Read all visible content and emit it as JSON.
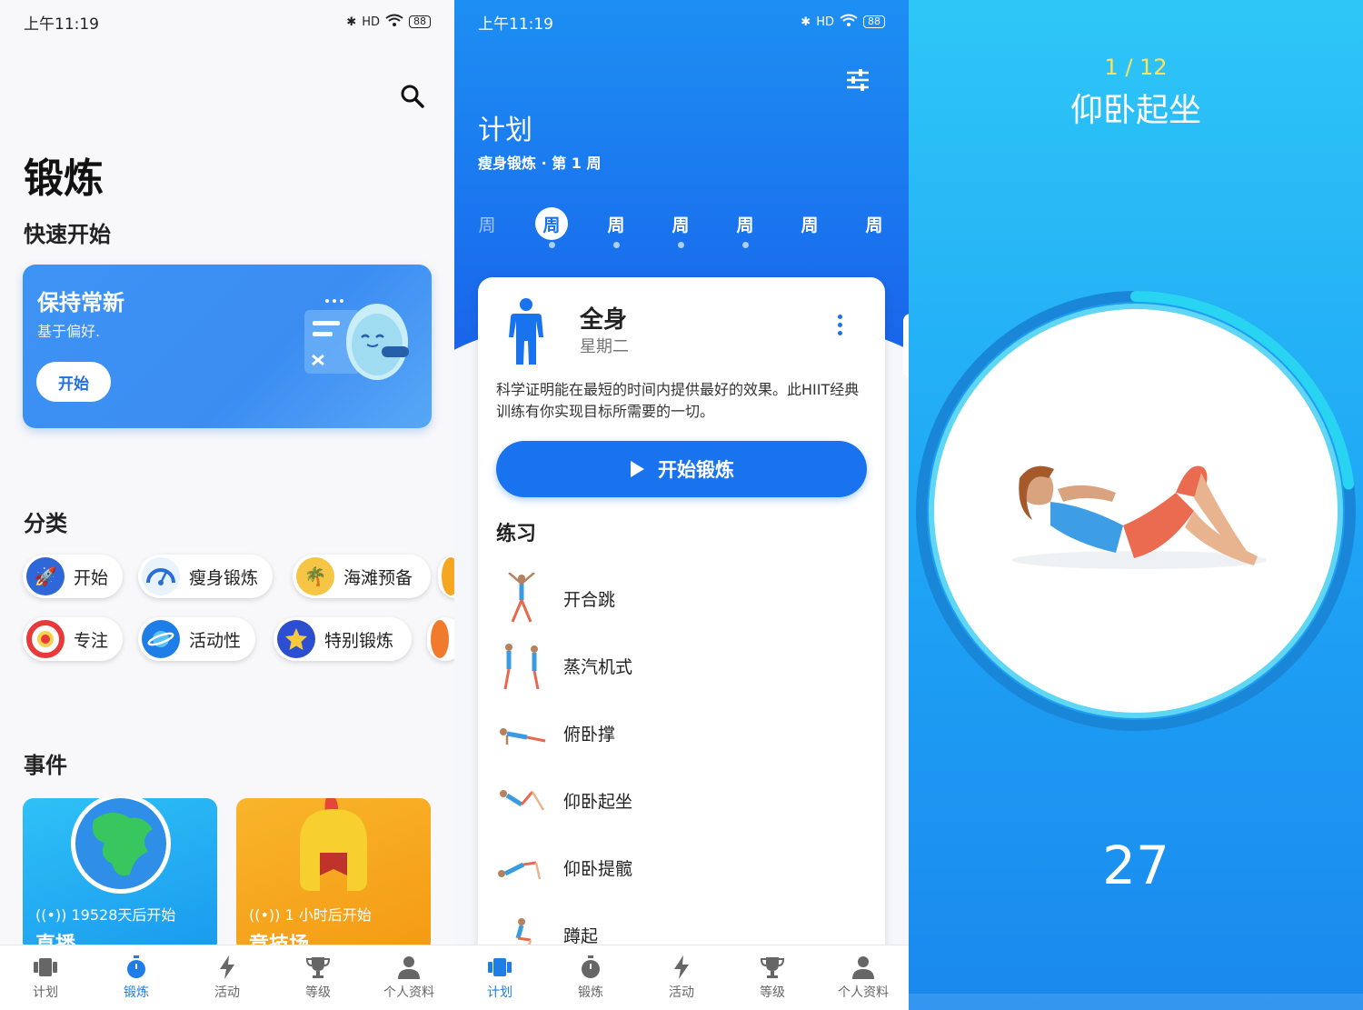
{
  "status_bar": {
    "time": "上午11:19",
    "battery": "88",
    "network": "HD"
  },
  "workout_screen": {
    "title": "锻炼",
    "quick_start": {
      "heading": "快速开始",
      "card_title": "保持常新",
      "card_subtitle": "基于偏好.",
      "button_label": "开始"
    },
    "categories": {
      "heading": "分类",
      "items": [
        {
          "label": "开始",
          "icon": "rocket-icon"
        },
        {
          "label": "瘦身锻炼",
          "icon": "scale-icon"
        },
        {
          "label": "海滩预备",
          "icon": "beach-icon"
        },
        {
          "label": "专注",
          "icon": "target-icon"
        },
        {
          "label": "活动性",
          "icon": "planet-icon"
        },
        {
          "label": "特别锻炼",
          "icon": "star-icon"
        }
      ]
    },
    "events": {
      "heading": "事件",
      "items": [
        {
          "time": "19528天后开始",
          "name": "直播",
          "icon": "globe-icon",
          "color": "#1aa4f0"
        },
        {
          "time": "1 小时后开始",
          "name": "竞技场",
          "icon": "helmet-icon",
          "color": "#f7a21a"
        }
      ]
    }
  },
  "plan_screen": {
    "title": "计划",
    "subtitle": "瘦身锻炼 · 第 1 周",
    "weeks": [
      "周",
      "周",
      "周",
      "周",
      "周",
      "周",
      "周"
    ],
    "active_week_index": 1,
    "card": {
      "title": "全身",
      "day": "星期二",
      "description": "科学证明能在最短的时间内提供最好的效果。此HIIT经典训练有你实现目标所需要的一切。",
      "start_label": "开始锻炼"
    },
    "exercises_heading": "练习",
    "exercises": [
      "开合跳",
      "蒸汽机式",
      "俯卧撑",
      "仰卧起坐",
      "仰卧提髋",
      "蹲起"
    ]
  },
  "tabbar": {
    "items": [
      {
        "label": "计划",
        "icon": "plan-icon"
      },
      {
        "label": "锻炼",
        "icon": "stopwatch-icon"
      },
      {
        "label": "活动",
        "icon": "lightning-icon"
      },
      {
        "label": "等级",
        "icon": "trophy-icon"
      },
      {
        "label": "个人资料",
        "icon": "person-icon"
      }
    ]
  },
  "exercise_screen": {
    "progress": "1 / 12",
    "exercise_name": "仰卧起坐",
    "timer": "27",
    "ring_progress": 0.23
  },
  "colors": {
    "accent": "#1a73ee",
    "hero": "#3c8df2",
    "progress_ring": "#29d3f2",
    "counter": "#ffe25a"
  }
}
